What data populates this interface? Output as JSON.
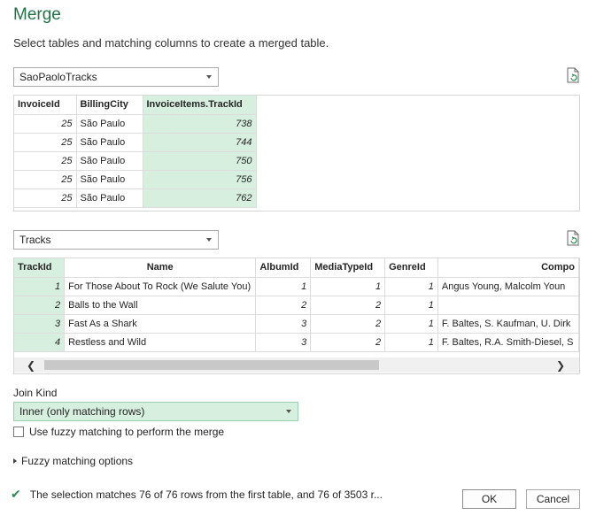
{
  "dialog": {
    "title": "Merge",
    "subtitle": "Select tables and matching columns to create a merged table."
  },
  "first_table": {
    "selected": "SaoPaoloTracks",
    "columns": [
      "InvoiceId",
      "BillingCity",
      "InvoiceItems.TrackId"
    ],
    "rows": [
      [
        "25",
        "São Paulo",
        "738"
      ],
      [
        "25",
        "São Paulo",
        "744"
      ],
      [
        "25",
        "São Paulo",
        "750"
      ],
      [
        "25",
        "São Paulo",
        "756"
      ],
      [
        "25",
        "São Paulo",
        "762"
      ]
    ]
  },
  "second_table": {
    "selected": "Tracks",
    "columns": [
      "TrackId",
      "Name",
      "AlbumId",
      "MediaTypeId",
      "GenreId",
      "Compo"
    ],
    "rows": [
      [
        "1",
        "For Those About To Rock (We Salute You)",
        "1",
        "1",
        "1",
        "Angus Young, Malcolm Youn"
      ],
      [
        "2",
        "Balls to the Wall",
        "2",
        "2",
        "1",
        ""
      ],
      [
        "3",
        "Fast As a Shark",
        "3",
        "2",
        "1",
        "F. Baltes, S. Kaufman, U. Dirk"
      ],
      [
        "4",
        "Restless and Wild",
        "3",
        "2",
        "1",
        "F. Baltes, R.A. Smith-Diesel, S"
      ]
    ]
  },
  "join": {
    "label": "Join Kind",
    "selected": "Inner (only matching rows)",
    "fuzzy_checkbox_label": "Use fuzzy matching to perform the merge",
    "fuzzy_options_label": "Fuzzy matching options"
  },
  "status": {
    "text": "The selection matches 76 of 76 rows from the first table, and 76 of 3503 r..."
  },
  "buttons": {
    "ok": "OK",
    "cancel": "Cancel"
  },
  "colors": {
    "accent": "#217346",
    "selected_column": "#d7efdf",
    "check": "#2f8a4f"
  }
}
